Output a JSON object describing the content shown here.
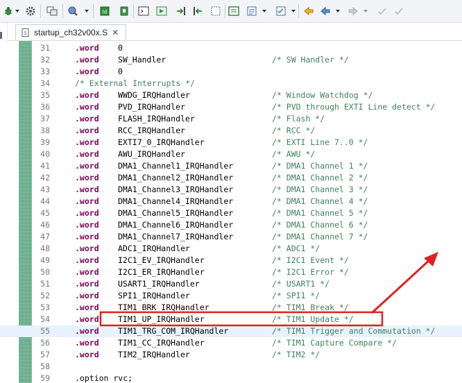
{
  "toolbar": {
    "icons": [
      "bug-icon",
      "gear-icon",
      "console-icon",
      "search-icon",
      "chip-icon",
      "shield-icon",
      "terminal-icon",
      "download-icon",
      "step-into-icon",
      "step-over-icon",
      "page-icon",
      "window-icon",
      "list-icon",
      "task-icon",
      "back-arrow-icon",
      "forward-arrow-icon",
      "undo-icon",
      "redo-icon"
    ]
  },
  "editor": {
    "tab_label": "startup_ch32v00x.S",
    "tab_close": "✕",
    "lines": [
      {
        "num": "31",
        "kw": ".word",
        "val": "0",
        "comment": ""
      },
      {
        "num": "32",
        "kw": ".word",
        "val": "SW_Handler",
        "comment": "/* SW Handler */"
      },
      {
        "num": "33",
        "kw": ".word",
        "val": "0",
        "comment": ""
      },
      {
        "num": "34",
        "kw": "",
        "val": "",
        "comment": "/* External Interrupts */"
      },
      {
        "num": "35",
        "kw": ".word",
        "val": "WWDG_IRQHandler",
        "comment": "/* Window Watchdog */"
      },
      {
        "num": "36",
        "kw": ".word",
        "val": "PVD_IRQHandler",
        "comment": "/* PVD through EXTI Line detect */"
      },
      {
        "num": "37",
        "kw": ".word",
        "val": "FLASH_IRQHandler",
        "comment": "/* Flash */"
      },
      {
        "num": "38",
        "kw": ".word",
        "val": "RCC_IRQHandler",
        "comment": "/* RCC */"
      },
      {
        "num": "39",
        "kw": ".word",
        "val": "EXTI7_0_IRQHandler",
        "comment": "/* EXTI Line 7..0 */"
      },
      {
        "num": "40",
        "kw": ".word",
        "val": "AWU_IRQHandler",
        "comment": "/* AWU */"
      },
      {
        "num": "41",
        "kw": ".word",
        "val": "DMA1_Channel1_IRQHandler",
        "comment": "/* DMA1 Channel 1 */"
      },
      {
        "num": "42",
        "kw": ".word",
        "val": "DMA1_Channel2_IRQHandler",
        "comment": "/* DMA1 Channel 2 */"
      },
      {
        "num": "43",
        "kw": ".word",
        "val": "DMA1_Channel3_IRQHandler",
        "comment": "/* DMA1 Channel 3 */"
      },
      {
        "num": "44",
        "kw": ".word",
        "val": "DMA1_Channel4_IRQHandler",
        "comment": "/* DMA1 Channel 4 */"
      },
      {
        "num": "45",
        "kw": ".word",
        "val": "DMA1_Channel5_IRQHandler",
        "comment": "/* DMA1 Channel 5 */"
      },
      {
        "num": "46",
        "kw": ".word",
        "val": "DMA1_Channel6_IRQHandler",
        "comment": "/* DMA1 Channel 6 */"
      },
      {
        "num": "47",
        "kw": ".word",
        "val": "DMA1_Channel7_IRQHandler",
        "comment": "/* DMA1 Channel 7 */"
      },
      {
        "num": "48",
        "kw": ".word",
        "val": "ADC1_IRQHandler",
        "comment": "/* ADC1 */"
      },
      {
        "num": "49",
        "kw": ".word",
        "val": "I2C1_EV_IRQHandler",
        "comment": "/* I2C1 Event */"
      },
      {
        "num": "50",
        "kw": ".word",
        "val": "I2C1_ER_IRQHandler",
        "comment": "/* I2C1 Error */"
      },
      {
        "num": "51",
        "kw": ".word",
        "val": "USART1_IRQHandler",
        "comment": "/* USART1 */"
      },
      {
        "num": "52",
        "kw": ".word",
        "val": "SPI1_IRQHandler",
        "comment": "/* SPI1 */"
      },
      {
        "num": "53",
        "kw": ".word",
        "val": "TIM1_BRK_IRQHandler",
        "comment": "/* TIM1 Break */"
      },
      {
        "num": "54",
        "kw": ".word",
        "val": "TIM1_UP_IRQHandler",
        "comment": "/* TIM1 Update */"
      },
      {
        "num": "55",
        "kw": ".word",
        "val": "TIM1_TRG_COM_IRQHandler",
        "comment": "/* TIM1 Trigger and Commutation */"
      },
      {
        "num": "56",
        "kw": ".word",
        "val": "TIM1_CC_IRQHandler",
        "comment": "/* TIM1 Capture Compare */"
      },
      {
        "num": "57",
        "kw": ".word",
        "val": "TIM2_IRQHandler",
        "comment": "/* TIM2 */"
      },
      {
        "num": "58",
        "kw": "",
        "val": "",
        "comment": ""
      },
      {
        "num": "59",
        "kw": "",
        "val": "",
        "comment": "",
        "plain": ".option rvc;"
      }
    ]
  },
  "colors": {
    "keyword": "#7f0055",
    "comment": "#3f7f5f",
    "line_number": "#787878",
    "current_line": "#e8f2fe",
    "annotation_red": "#e02020"
  }
}
